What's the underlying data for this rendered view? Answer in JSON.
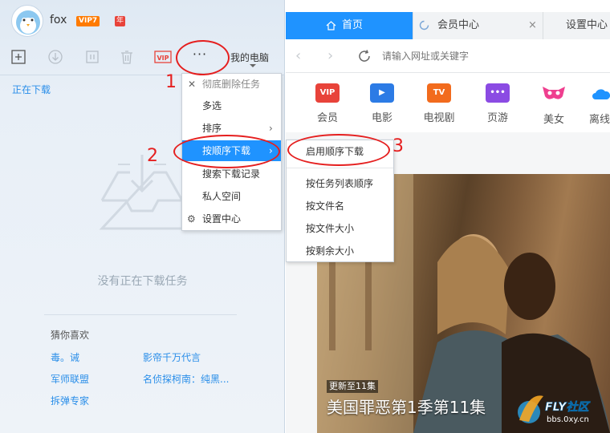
{
  "user": {
    "name": "fox",
    "vip": "VIP7",
    "year_badge": "年"
  },
  "toolbar": {
    "more": "···",
    "location": "我的电脑"
  },
  "left": {
    "tab_downloading": "正在下载",
    "empty_text": "没有正在下载任务",
    "guess": {
      "title": "猜你喜欢",
      "links": [
        "毒。诫",
        "影帝千万代言",
        "军师联盟",
        "名侦探柯南：纯黑...",
        "拆弹专家"
      ]
    }
  },
  "more_menu": {
    "items": [
      "彻底删除任务",
      "多选",
      "排序",
      "按顺序下载",
      "搜索下载记录",
      "私人空间",
      "设置中心"
    ]
  },
  "order_submenu": {
    "items": [
      "启用顺序下载",
      "按任务列表顺序",
      "按文件名",
      "按文件大小",
      "按剩余大小"
    ]
  },
  "browser": {
    "tabs": [
      "首页",
      "会员中心",
      "设置中心"
    ],
    "tab_close": "×",
    "url_placeholder": "请输入网址或关键字",
    "quick_links": [
      {
        "label": "会员",
        "icon_text": "VIP",
        "color": "#e8433a"
      },
      {
        "label": "电影",
        "icon_text": "▶",
        "color": "#2c7be5"
      },
      {
        "label": "电视剧",
        "icon_text": "TV",
        "color": "#f26b1d"
      },
      {
        "label": "页游",
        "icon_text": "•••",
        "color": "#8b4be3"
      },
      {
        "label": "美女",
        "icon_text": "",
        "color": "#ef3f8f"
      },
      {
        "label": "离线",
        "icon_text": "",
        "color": "#1f93ff"
      }
    ],
    "poster": {
      "tag": "更新至11集",
      "title": "美国罪恶第1季第11集"
    }
  },
  "annotations": {
    "n1": "1",
    "n2": "2",
    "n3": "3"
  },
  "watermark": {
    "brand": "FLY社区",
    "url": "bbs.0xy.cn"
  },
  "colors": {
    "accent": "#1f93ff",
    "annotation": "#e51f1f",
    "vip": "#ff7b00"
  }
}
